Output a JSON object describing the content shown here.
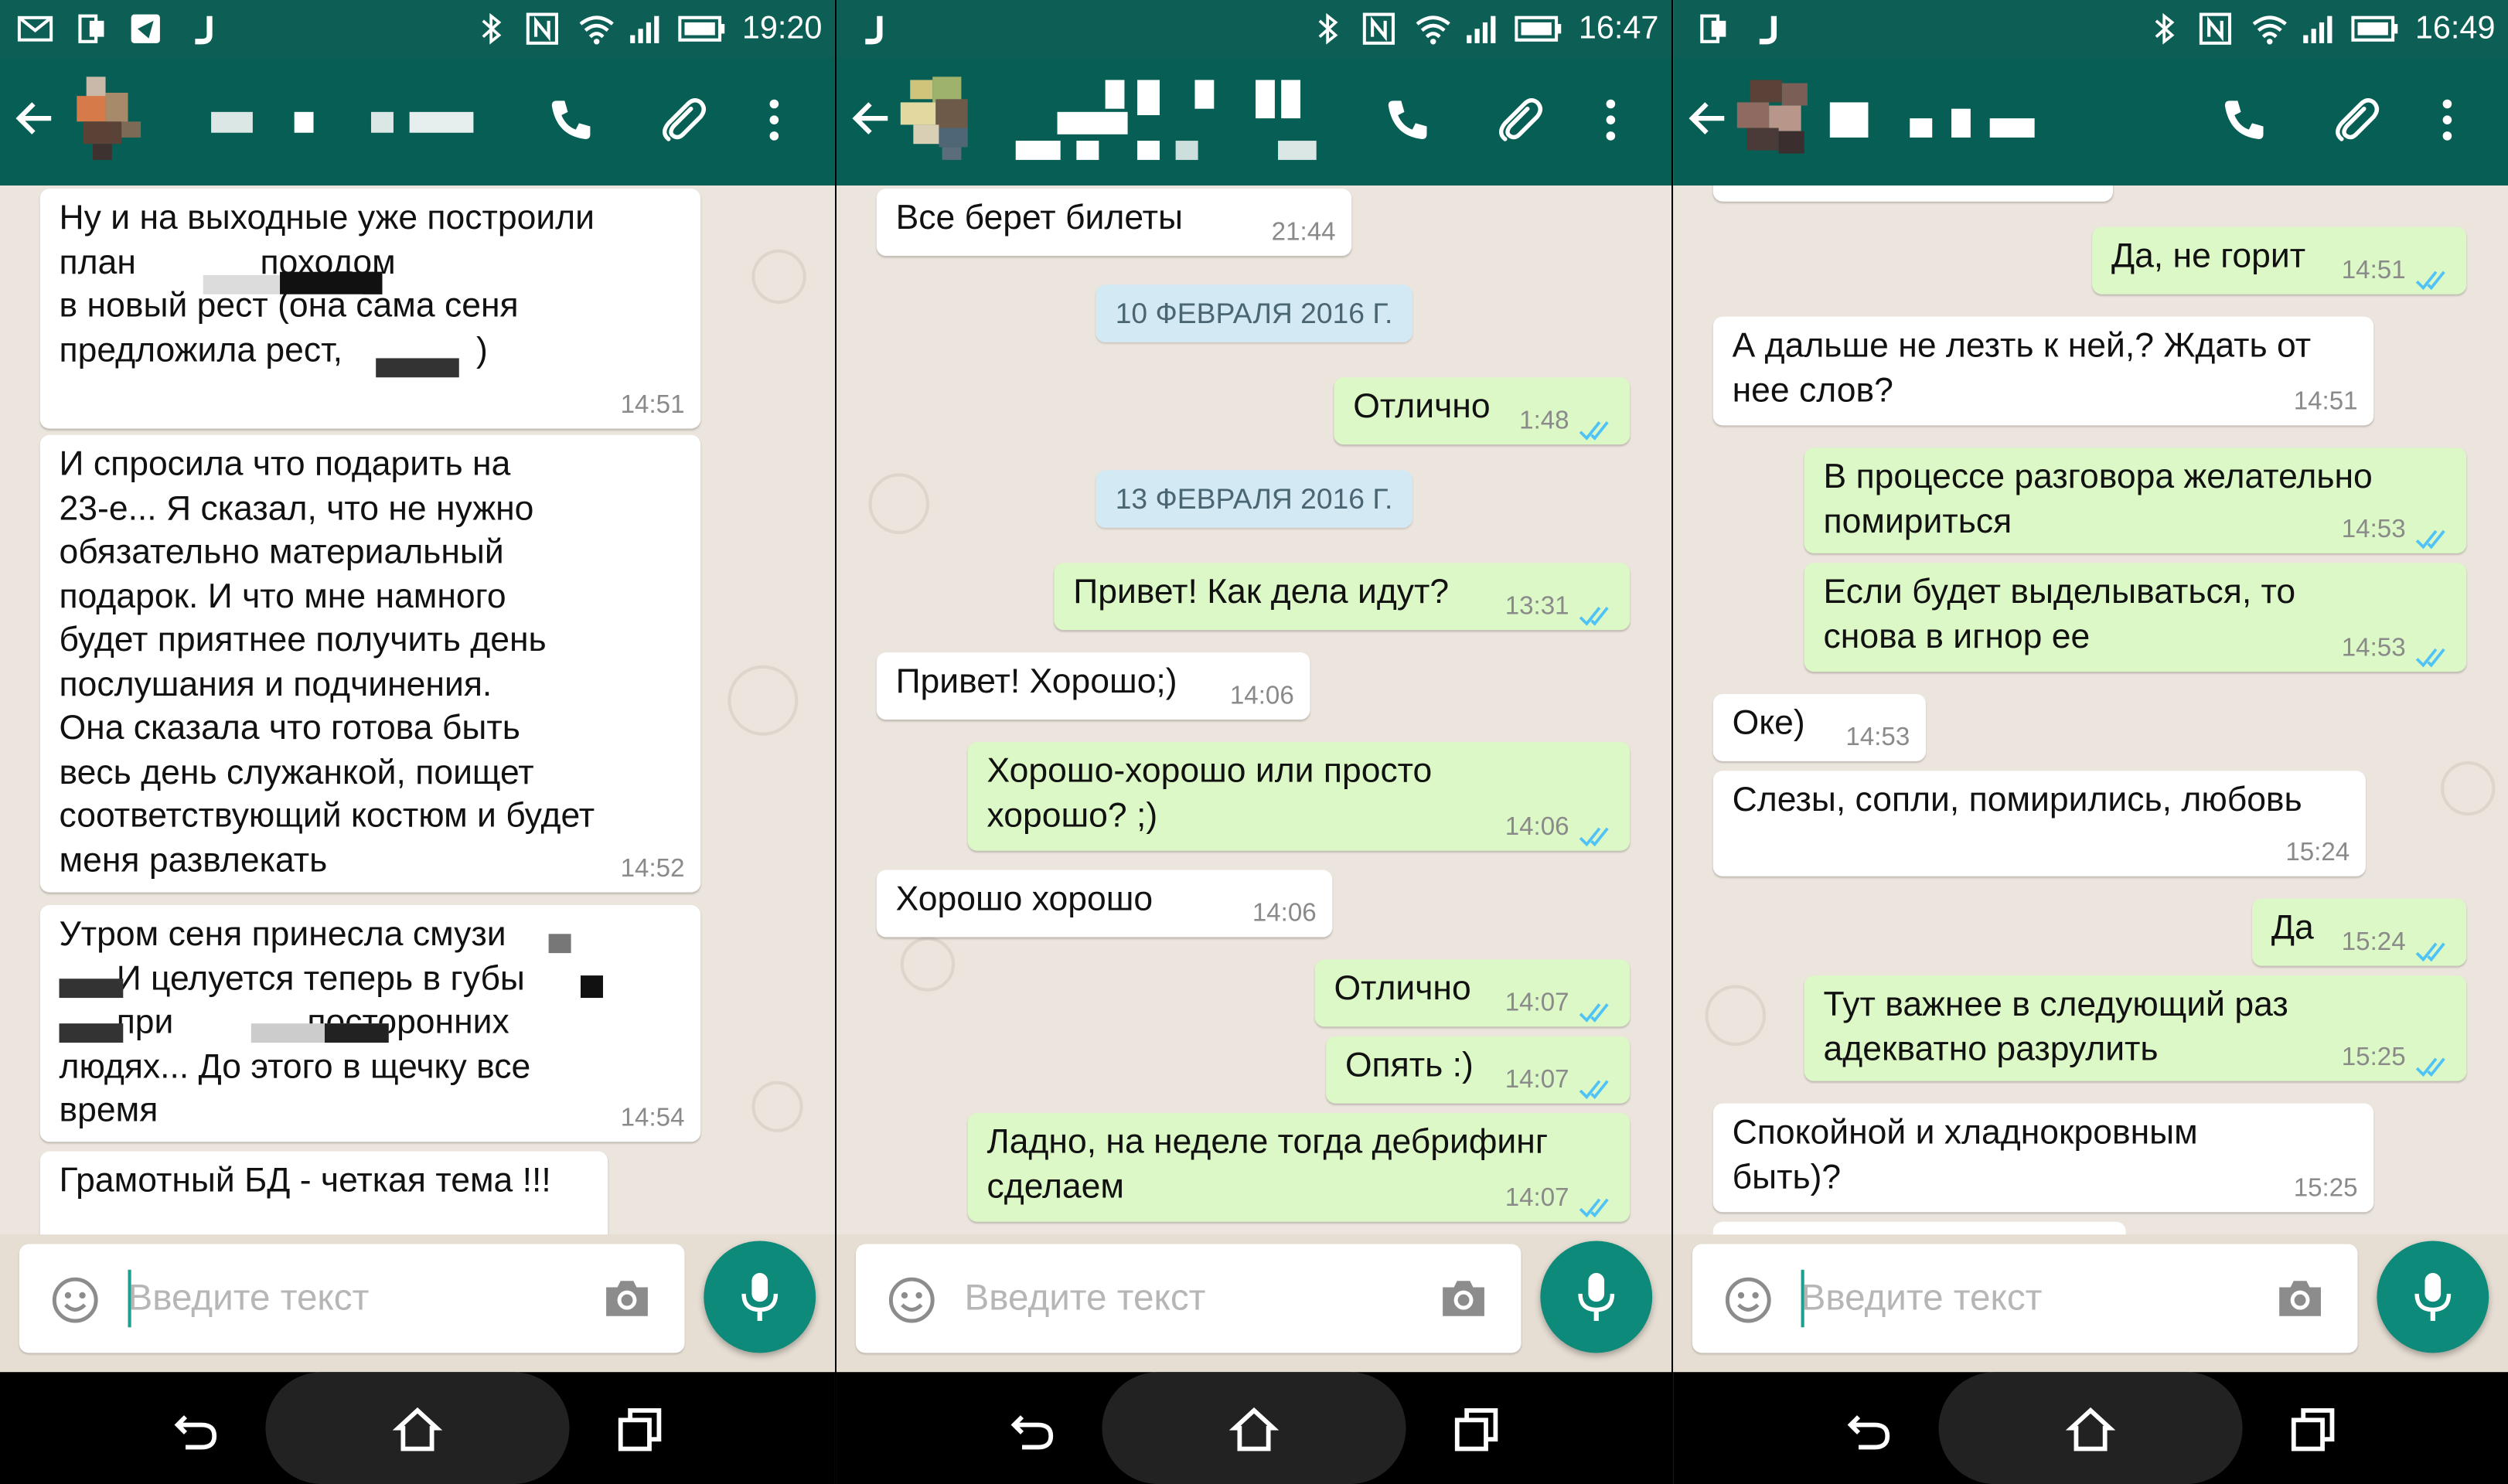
{
  "panels": [
    {
      "status": {
        "time": "19:20"
      },
      "composer": {
        "placeholder": "Введите текст"
      },
      "messages": [
        {
          "text": "Ну и на выходные уже построили\nплан             походом\nв новый рест (она сама сеня\nпредложила рест,              )",
          "time": "14:51"
        },
        {
          "text": "И спросила что подарить на\n23-е... Я сказал, что не нужно\nобязательно материальный\nподарок. И что мне намного\nбудет приятнее получить день\nпослушания и подчинения.\nОна сказала что готова быть\nвесь день служанкой, поищет\nсоответствующий костюм и будет\nменя развлекать",
          "time": "14:52"
        },
        {
          "text": "Утром сеня принесла смузи\n      И целуется теперь в губы\n      при              посторонних\nлюдях... До этого в щечку все\nвремя",
          "time": "14:54"
        },
        {
          "text": "Грамотный БД - четкая тема !!!",
          "time": ""
        }
      ]
    },
    {
      "status": {
        "time": "16:47"
      },
      "composer": {
        "placeholder": "Введите текст"
      },
      "dates": [
        "10 ФЕВРАЛЯ 2016 Г.",
        "13 ФЕВРАЛЯ 2016 Г."
      ],
      "messages": [
        {
          "text": "Все берет билеты",
          "time": "21:44"
        },
        {
          "text": "Отлично",
          "time": "1:48"
        },
        {
          "text": "Привет! Как дела идут?",
          "time": "13:31"
        },
        {
          "text": "Привет! Хорошо;)",
          "time": "14:06"
        },
        {
          "text": "Хорошо-хорошо или просто\nхорошо? ;)",
          "time": "14:06"
        },
        {
          "text": "Хорошо хорошо",
          "time": "14:06"
        },
        {
          "text": "Отлично",
          "time": "14:07"
        },
        {
          "text": "Опять :)",
          "time": "14:07"
        },
        {
          "text": "Ладно, на неделе тогда дебрифинг\nсделаем",
          "time": "14:07"
        }
      ]
    },
    {
      "status": {
        "time": "16:49"
      },
      "composer": {
        "placeholder": "Введите текст"
      },
      "messages": [
        {
          "text": "Да, не горит",
          "time": "14:51"
        },
        {
          "text": "А дальше не лезть к ней,? Ждать от\nнее слов?",
          "time": "14:51"
        },
        {
          "text": "В процессе разговора желательно\nпомириться",
          "time": "14:53"
        },
        {
          "text": "Если будет выделываться, то\nснова в игнор ее",
          "time": "14:53"
        },
        {
          "text": "Оке)",
          "time": "14:53"
        },
        {
          "text": "Слезы, сопли, помирились, любовь",
          "time": "15:24"
        },
        {
          "text": "Да",
          "time": "15:24"
        },
        {
          "text": "Тут важнее в следующий раз\nадекватно разрулить",
          "time": "15:25"
        },
        {
          "text": "Спокойной и хладнокровным\nбыть)?",
          "time": "15:25"
        }
      ]
    }
  ],
  "icons": {
    "back": "arrow-left-icon",
    "call": "phone-icon",
    "attach": "paperclip-icon",
    "menu": "more-vert-icon",
    "emoji": "smiley-icon",
    "camera": "camera-icon",
    "mic": "mic-icon",
    "nav_back": "nav-back-icon",
    "nav_home": "nav-home-icon",
    "nav_recent": "nav-recent-icon"
  },
  "colors": {
    "app_bar": "#075e54",
    "incoming": "#ffffff",
    "outgoing": "#dcf8c6",
    "accent": "#0d8a7a",
    "read_ticks": "#4fc3f7",
    "date_chip": "#d3e9f4"
  }
}
